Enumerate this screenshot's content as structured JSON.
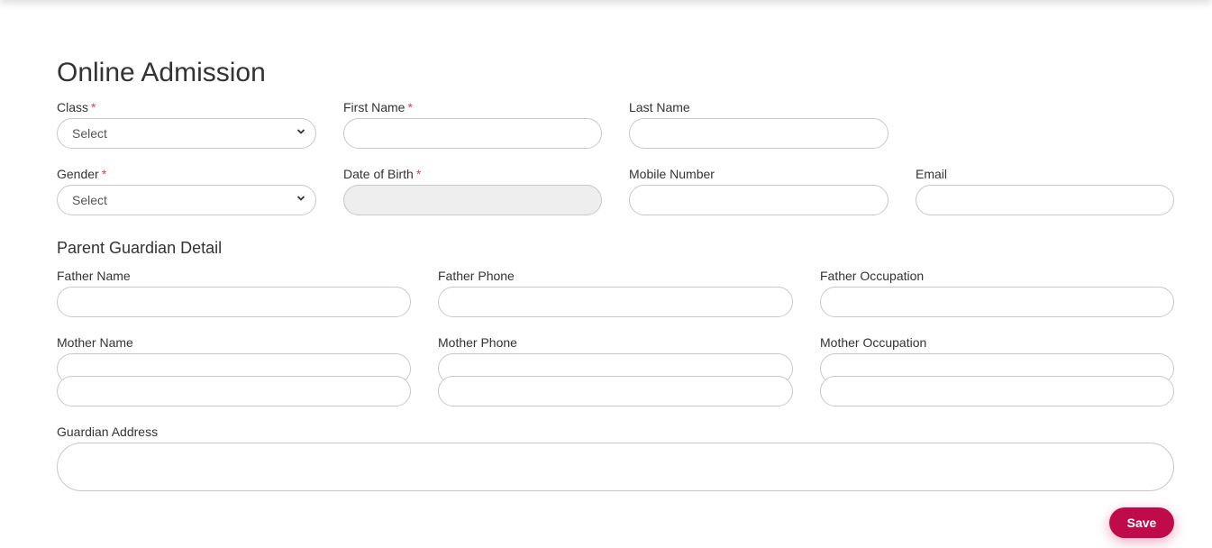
{
  "page": {
    "title": "Online Admission",
    "required_marker": "*"
  },
  "student": {
    "class": {
      "label": "Class",
      "value": "Select",
      "required": true
    },
    "first_name": {
      "label": "First Name",
      "value": "",
      "required": true
    },
    "last_name": {
      "label": "Last Name",
      "value": ""
    },
    "gender": {
      "label": "Gender",
      "value": "Select",
      "required": true
    },
    "dob": {
      "label": "Date of Birth",
      "value": "",
      "required": true
    },
    "mobile": {
      "label": "Mobile Number",
      "value": ""
    },
    "email": {
      "label": "Email",
      "value": ""
    }
  },
  "guardian": {
    "section_title": "Parent Guardian Detail",
    "father_name": {
      "label": "Father Name",
      "value": ""
    },
    "father_phone": {
      "label": "Father Phone",
      "value": ""
    },
    "father_occupation": {
      "label": "Father Occupation",
      "value": ""
    },
    "mother_name": {
      "label": "Mother Name",
      "value": ""
    },
    "mother_phone": {
      "label": "Mother Phone",
      "value": ""
    },
    "mother_occupation": {
      "label": "Mother Occupation",
      "value": ""
    },
    "address": {
      "label": "Guardian Address",
      "value": ""
    }
  },
  "actions": {
    "save_label": "Save"
  },
  "colors": {
    "accent": "#c00b4a",
    "required": "#e0434a",
    "readonly_bg": "#eeeeee",
    "border": "#c8c8c8"
  }
}
